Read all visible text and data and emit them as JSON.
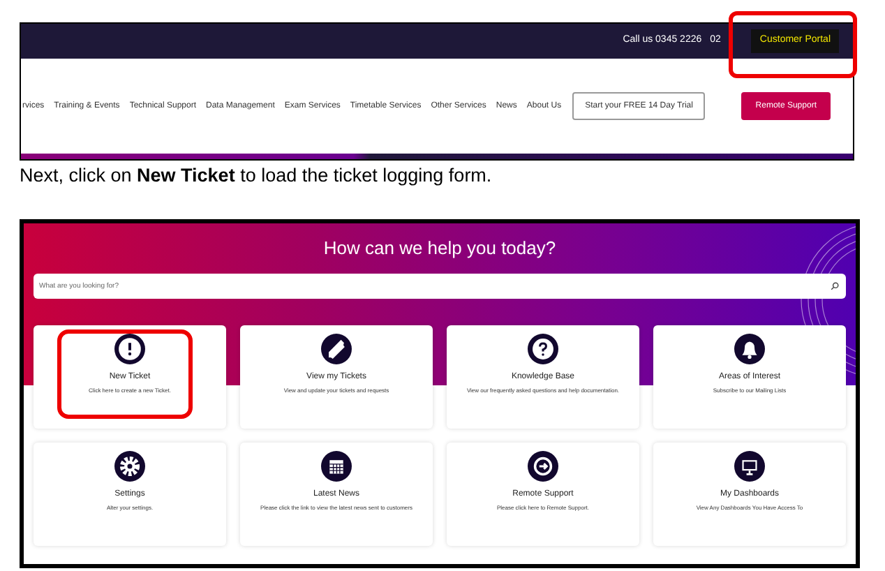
{
  "website_header": {
    "phone": [
      "Call us 0345 2226",
      "02"
    ],
    "customer_portal": {
      "label": "Customer Portal",
      "highlighted": true
    },
    "nav_items": [
      "rvices",
      "Training & Events",
      "Technical Support",
      "Data Management",
      "Exam Services",
      "Timetable Services",
      "Other Services",
      "News",
      "About Us"
    ],
    "trial_button": "Start your FREE 14 Day Trial",
    "remote_button": "Remote Support"
  },
  "instruction": "Next, click on **New Ticket** to load the ticket logging form.",
  "portal": {
    "title": "How can we help you today?",
    "search": {
      "placeholder": "What are you looking for?"
    },
    "cards": [
      {
        "title": "New Ticket",
        "description": "Click here to create a new Ticket.",
        "highlighted": true
      },
      {
        "title": "View my Tickets",
        "description": "View and update your tickets and requests",
        "highlighted": false
      },
      {
        "title": "Knowledge Base",
        "description": "View our frequently asked questions and help documentation.",
        "highlighted": false
      },
      {
        "title": "Areas of Interest",
        "description": "Subscribe to our Mailing Lists",
        "highlighted": false
      },
      {
        "title": "Settings",
        "description": "Alter your settings.",
        "highlighted": false
      },
      {
        "title": "Latest News",
        "description": "Please click the link to view the latest news sent to customers",
        "highlighted": false
      },
      {
        "title": "Remote Support",
        "description": "Please click here to Remote Support.",
        "highlighted": false
      },
      {
        "title": "My Dashboards",
        "description": "View Any Dashboards You Have Access To",
        "highlighted": false
      }
    ]
  }
}
